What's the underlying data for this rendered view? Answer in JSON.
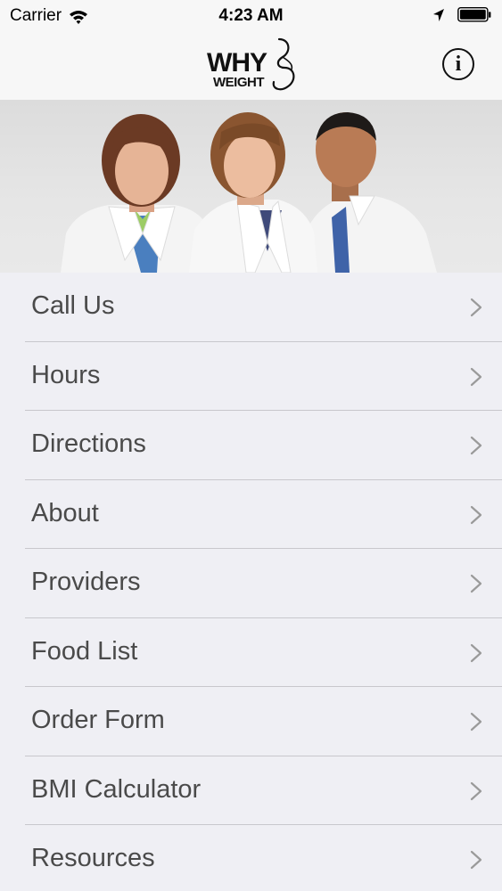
{
  "status_bar": {
    "carrier": "Carrier",
    "time": "4:23 AM"
  },
  "nav": {
    "logo_top": "WHY",
    "logo_bottom": "WEIGHT",
    "info_glyph": "i"
  },
  "menu": {
    "items": [
      {
        "label": "Call Us"
      },
      {
        "label": "Hours"
      },
      {
        "label": "Directions"
      },
      {
        "label": "About"
      },
      {
        "label": "Providers"
      },
      {
        "label": "Food List"
      },
      {
        "label": "Order Form"
      },
      {
        "label": "BMI Calculator"
      },
      {
        "label": "Resources"
      }
    ]
  },
  "colors": {
    "background": "#efeff4",
    "bar": "#f7f7f7",
    "label_text": "#4a4a4a",
    "chevron": "#9a9a9a",
    "separator": "#c8c7cc",
    "coat": "#f4f4f4"
  },
  "icons": {
    "wifi": "wifi-icon",
    "location": "location-arrow-icon",
    "battery": "battery-icon",
    "info": "info-icon",
    "chevron": "chevron-right-icon"
  }
}
